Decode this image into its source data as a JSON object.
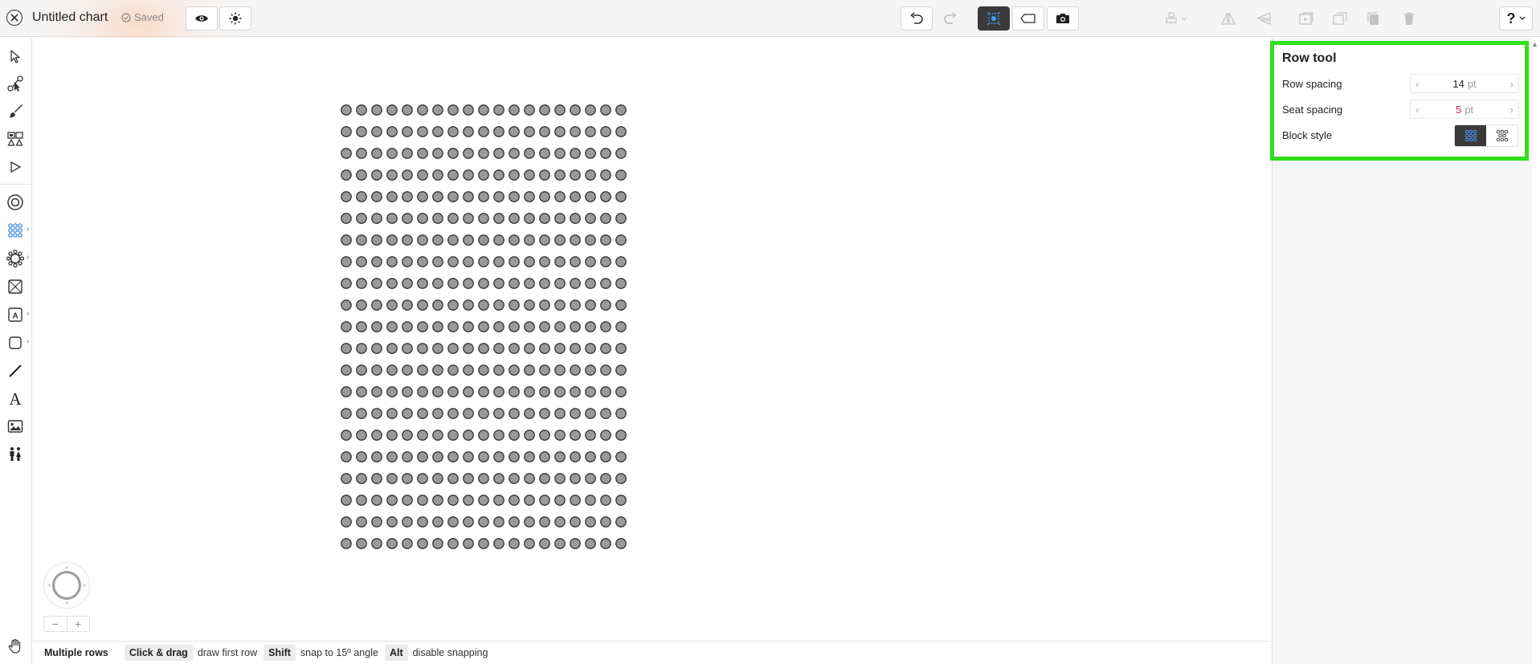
{
  "header": {
    "title": "Untitled chart",
    "saved_label": "Saved"
  },
  "canvas": {
    "seat_block": {
      "rows": 21,
      "seats_per_row": 19,
      "seat_fill": "#9a9a9a",
      "seat_stroke": "#333333"
    }
  },
  "status_bar": {
    "mode": "Multiple rows",
    "hints": [
      {
        "key": "Click & drag",
        "text": "draw first row"
      },
      {
        "key": "Shift",
        "text": "snap to 15º angle"
      },
      {
        "key": "Alt",
        "text": "disable snapping"
      }
    ]
  },
  "panel": {
    "title": "Row tool",
    "row_spacing": {
      "label": "Row spacing",
      "value": "14",
      "unit": "pt"
    },
    "seat_spacing": {
      "label": "Seat spacing",
      "value": "5",
      "unit": "pt"
    },
    "block_style": {
      "label": "Block style",
      "selected": "rows"
    }
  },
  "colors": {
    "highlight": "#2fe01a",
    "accent_blue": "#2a7de1",
    "seat_spacing_value": "#d6225a"
  }
}
